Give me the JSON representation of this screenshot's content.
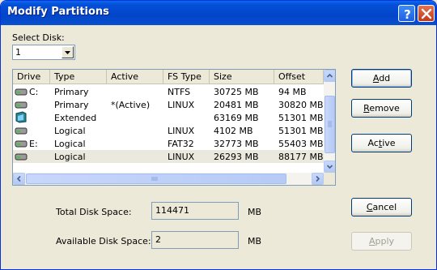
{
  "window": {
    "title": "Modify Partitions"
  },
  "select_disk": {
    "label": "Select Disk:",
    "value": "1"
  },
  "table": {
    "columns": [
      "Drive",
      "Type",
      "Active",
      "FS Type",
      "Size",
      "Offset"
    ],
    "rows": [
      {
        "icon": "hard-drive-icon",
        "drive": "C:",
        "type": "Primary",
        "active": "",
        "fs": "NTFS",
        "size": "30725 MB",
        "offset": "94 MB"
      },
      {
        "icon": "hard-drive-icon",
        "drive": "",
        "type": "Primary",
        "active": "*(Active)",
        "fs": "LINUX",
        "size": "20481 MB",
        "offset": "30820 MB"
      },
      {
        "icon": "extended-partition-icon",
        "drive": "",
        "type": "Extended",
        "active": "",
        "fs": "",
        "size": "63169 MB",
        "offset": "51301 MB"
      },
      {
        "icon": "hard-drive-icon",
        "drive": "",
        "type": "Logical",
        "active": "",
        "fs": "LINUX",
        "size": "4102 MB",
        "offset": "51301 MB"
      },
      {
        "icon": "hard-drive-icon",
        "drive": "E:",
        "type": "Logical",
        "active": "",
        "fs": "FAT32",
        "size": "32773 MB",
        "offset": "55403 MB"
      },
      {
        "icon": "hard-drive-icon",
        "drive": "",
        "type": "Logical",
        "active": "",
        "fs": "LINUX",
        "size": "26293 MB",
        "offset": "88177 MB"
      }
    ]
  },
  "buttons": {
    "add": {
      "accel": "A",
      "rest": "dd"
    },
    "remove": {
      "accel": "R",
      "rest": "emove"
    },
    "active": {
      "pre": "Ac",
      "accel": "t",
      "rest": "ive"
    },
    "cancel": {
      "accel": "C",
      "rest": "ancel"
    },
    "apply": {
      "accel": "A",
      "rest": "pply"
    }
  },
  "stats": {
    "total_label": "Total Disk Space:",
    "total_value": "114471",
    "total_unit": "MB",
    "available_label": "Available Disk Space:",
    "available_value": "2",
    "available_unit": "MB"
  }
}
